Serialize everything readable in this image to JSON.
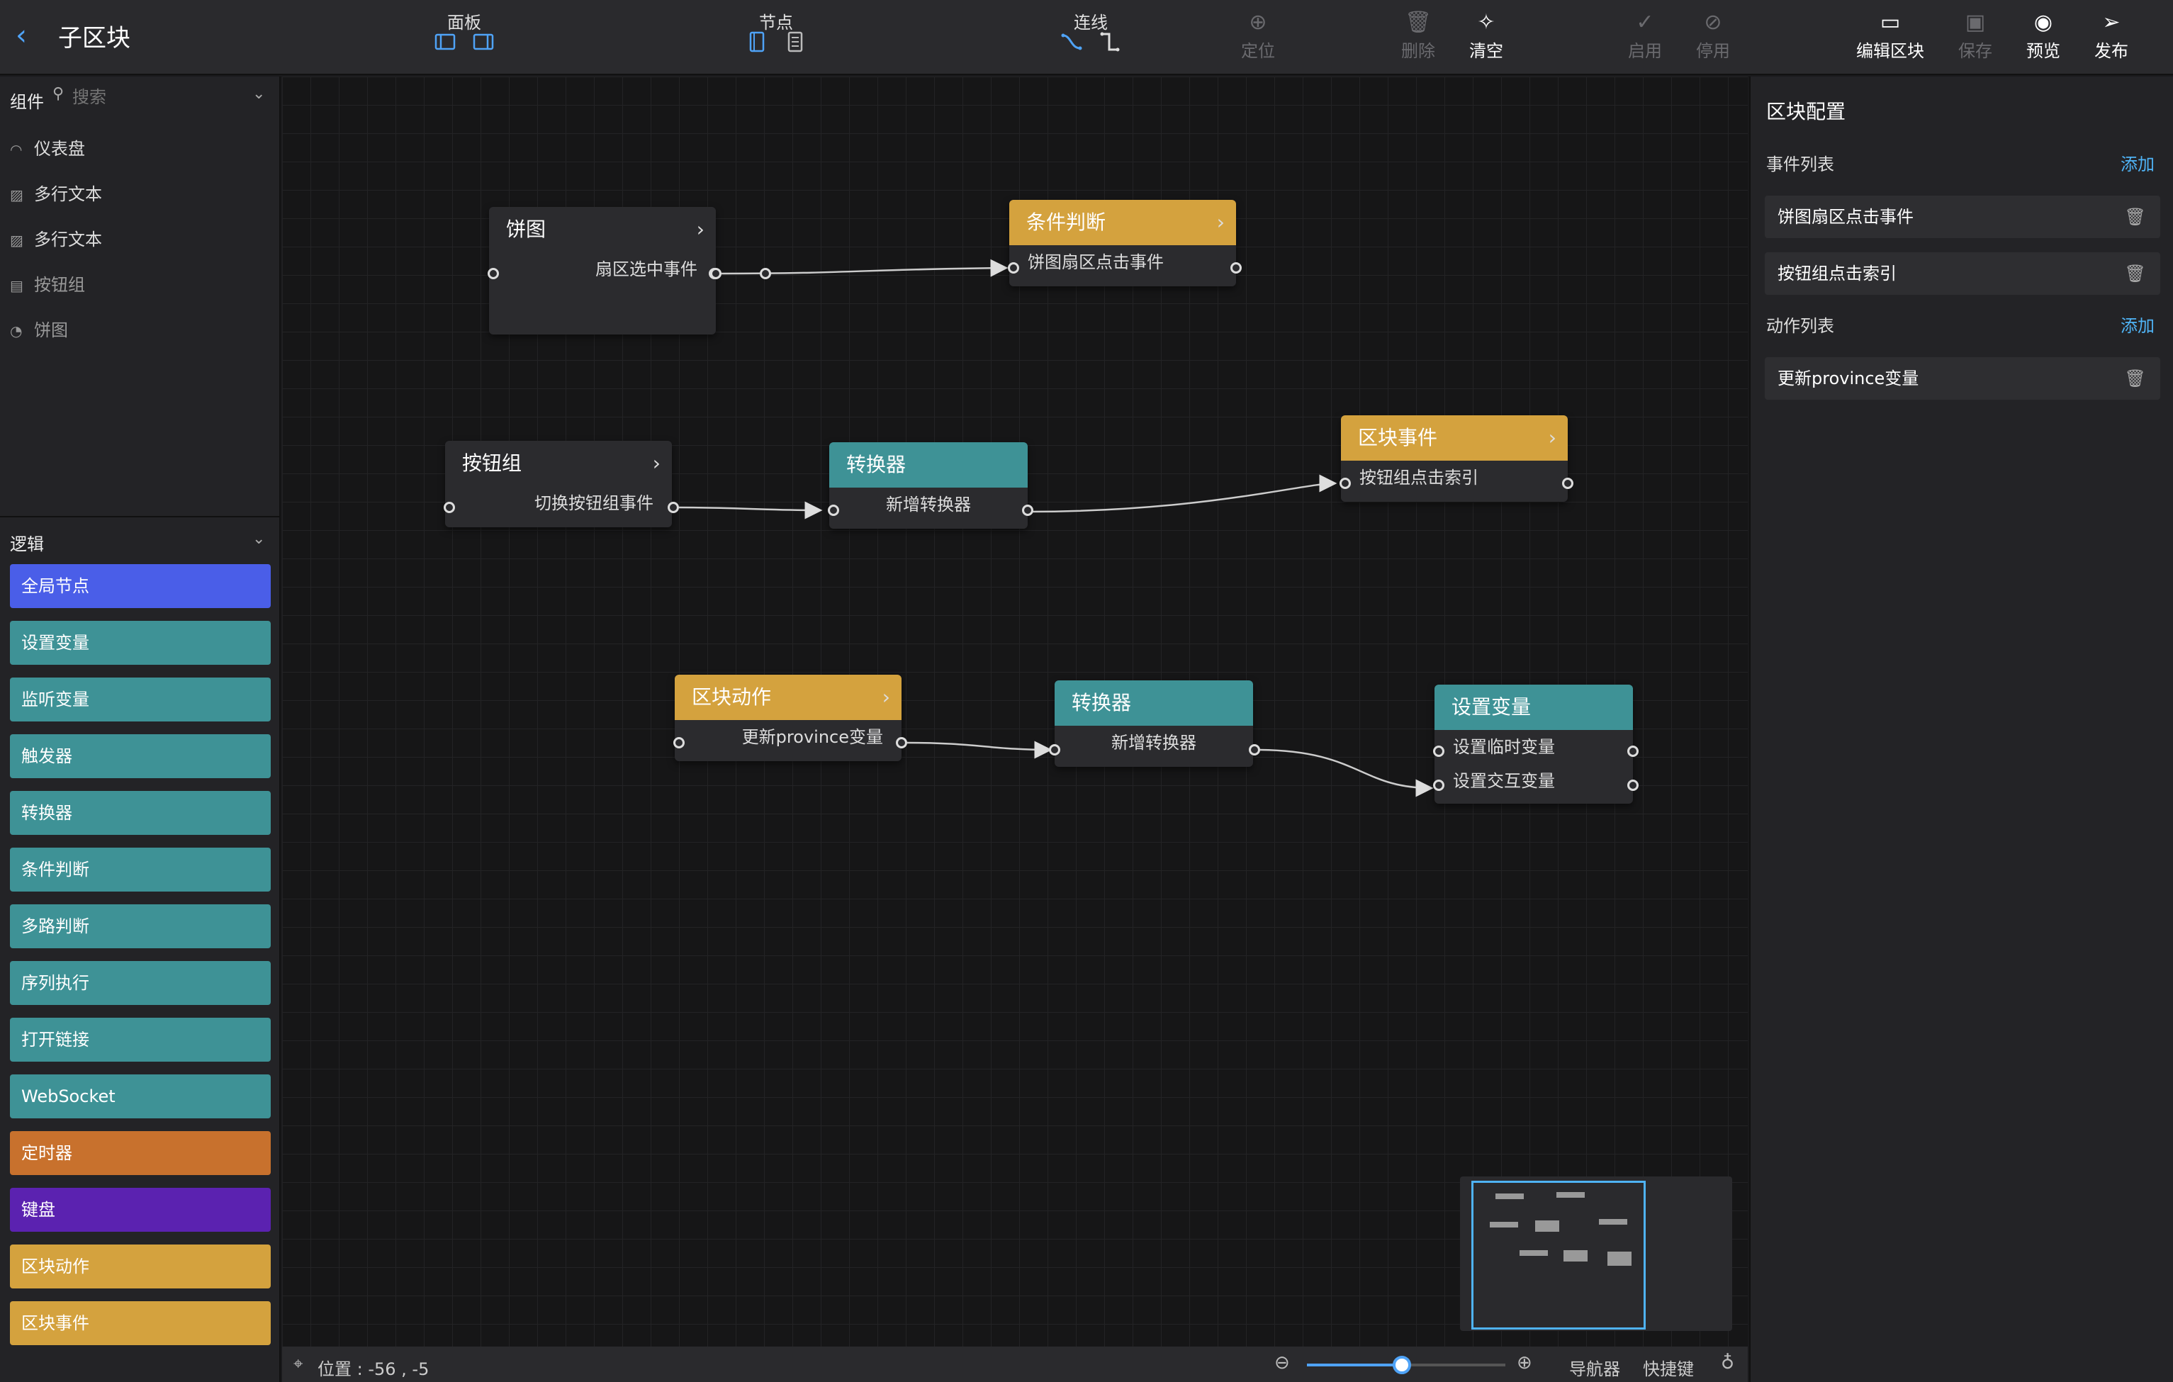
{
  "header": {
    "title": "子区块",
    "groups": {
      "panel": "面板",
      "node": "节点",
      "link": "连线"
    },
    "actions": {
      "locate": "定位",
      "delete": "删除",
      "clear": "清空",
      "enable": "启用",
      "disable": "停用",
      "edit_block": "编辑区块",
      "save": "保存",
      "preview": "预览",
      "publish": "发布"
    }
  },
  "left": {
    "components_label": "组件",
    "search_placeholder": "搜索",
    "components": [
      "仪表盘",
      "多行文本",
      "多行文本",
      "按钮组",
      "饼图"
    ],
    "logic_label": "逻辑",
    "logic_items": [
      {
        "label": "全局节点",
        "color": "#4a5ee8"
      },
      {
        "label": "设置变量",
        "color": "#3e9296"
      },
      {
        "label": "监听变量",
        "color": "#3e9296"
      },
      {
        "label": "触发器",
        "color": "#3e9296"
      },
      {
        "label": "转换器",
        "color": "#3e9296"
      },
      {
        "label": "条件判断",
        "color": "#3e9296"
      },
      {
        "label": "多路判断",
        "color": "#3e9296"
      },
      {
        "label": "序列执行",
        "color": "#3e9296"
      },
      {
        "label": "打开链接",
        "color": "#3e9296"
      },
      {
        "label": "WebSocket",
        "color": "#3e9296"
      },
      {
        "label": "定时器",
        "color": "#c8712d"
      },
      {
        "label": "键盘",
        "color": "#5b22b0"
      },
      {
        "label": "区块动作",
        "color": "#d4a23e"
      },
      {
        "label": "区块事件",
        "color": "#d4a23e"
      }
    ]
  },
  "nodes": {
    "pie": {
      "title": "饼图",
      "row": "扇区选中事件"
    },
    "cond": {
      "title": "条件判断",
      "row": "饼图扇区点击事件"
    },
    "btngroup": {
      "title": "按钮组",
      "row": "切换按钮组事件"
    },
    "conv1": {
      "title": "转换器",
      "row": "新增转换器"
    },
    "blockevt": {
      "title": "区块事件",
      "row": "按钮组点击索引"
    },
    "blockact": {
      "title": "区块动作",
      "row": "更新province变量"
    },
    "conv2": {
      "title": "转换器",
      "row": "新增转换器"
    },
    "setvar": {
      "title": "设置变量",
      "row1": "设置临时变量",
      "row2": "设置交互变量"
    }
  },
  "right": {
    "title": "区块配置",
    "event_list_label": "事件列表",
    "action_list_label": "动作列表",
    "add_label": "添加",
    "events": [
      "饼图扇区点击事件",
      "按钮组点击索引"
    ],
    "actions": [
      "更新province变量"
    ]
  },
  "status": {
    "position": "位置 : -56 , -5",
    "navigator": "导航器",
    "shortcuts": "快捷键",
    "zoom_fraction": 0.48
  }
}
